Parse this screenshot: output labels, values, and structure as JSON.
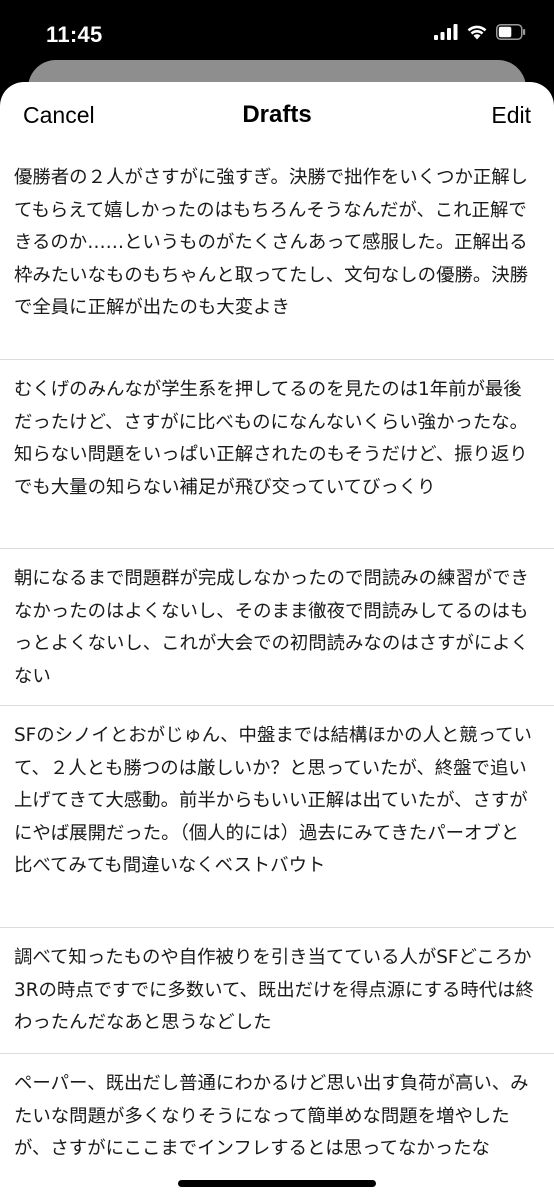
{
  "status": {
    "time": "11:45",
    "icons": [
      "cellular-signal-icon",
      "wifi-icon",
      "battery-icon"
    ]
  },
  "nav": {
    "cancel_label": "Cancel",
    "title": "Drafts",
    "edit_label": "Edit"
  },
  "drafts": [
    {
      "text": "優勝者の２人がさすがに強すぎ。決勝で拙作をいくつか正解してもらえて嬉しかったのはもちろんそうなんだが、これ正解できるのか……というものがたくさんあって感服した。正解出る枠みたいなものもちゃんと取ってたし、文句なしの優勝。決勝で全員に正解が出たのも大変よき"
    },
    {
      "text": "むくげのみんなが学生系を押してるのを見たのは1年前が最後だったけど、さすがに比べものになんないくらい強かったな。知らない問題をいっぱい正解されたのもそうだけど、振り返りでも大量の知らない補足が飛び交っていてびっくり"
    },
    {
      "text": "朝になるまで問題群が完成しなかったので問読みの練習ができなかったのはよくないし、そのまま徹夜で問読みしてるのはもっとよくないし、これが大会での初問読みなのはさすがによくない"
    },
    {
      "text": "SFのシノイとおがじゅん、中盤までは結構ほかの人と競っていて、２人とも勝つのは厳しいか？と思っていたが、終盤で追い上げてきて大感動。前半からもいい正解は出ていたが、さすがにやば展開だった。（個人的には）過去にみてきたパーオブと比べてみても間違いなくベストバウト"
    },
    {
      "text": "調べて知ったものや自作被りを引き当てている人がSFどころか3Rの時点ですでに多数いて、既出だけを得点源にする時代は終わったんだなあと思うなどした"
    },
    {
      "text": "ペーパー、既出だし普通にわかるけど思い出す負荷が高い、みたいな問題が多くなりそうになって簡単めな問題を増やしたが、さすがにここまでインフレするとは思ってなかったな"
    }
  ]
}
